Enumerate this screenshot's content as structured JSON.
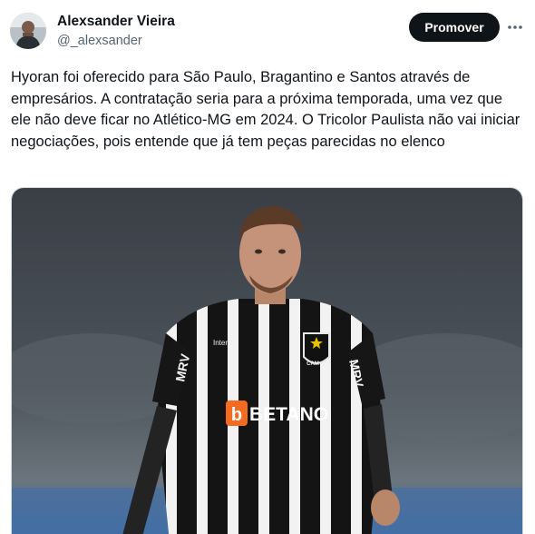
{
  "author": {
    "name": "Alexsander Vieira",
    "handle": "@_alexsander",
    "avatar_icon": "user-avatar-photo"
  },
  "actions": {
    "promote_label": "Promover",
    "more_icon": "more-dots-icon"
  },
  "tweet": {
    "text": "Hyoran foi oferecido para São Paulo, Bragantino e Santos através de empresários. A contratação seria para a próxima temporada, uma vez que ele não deve ficar no Atlético-MG em 2024. O Tricolor Paulista não vai iniciar negociações, pois entende que já tem peças parecidas no elenco"
  },
  "media": {
    "sponsor": "BETANO",
    "sleeve_left": "MRV",
    "sleeve_right": "MRV",
    "chest_small": "Inter",
    "crest": "CAM"
  },
  "colors": {
    "promote_bg": "#0f1419",
    "handle": "#536471",
    "sponsor_orange": "#f26b21"
  }
}
